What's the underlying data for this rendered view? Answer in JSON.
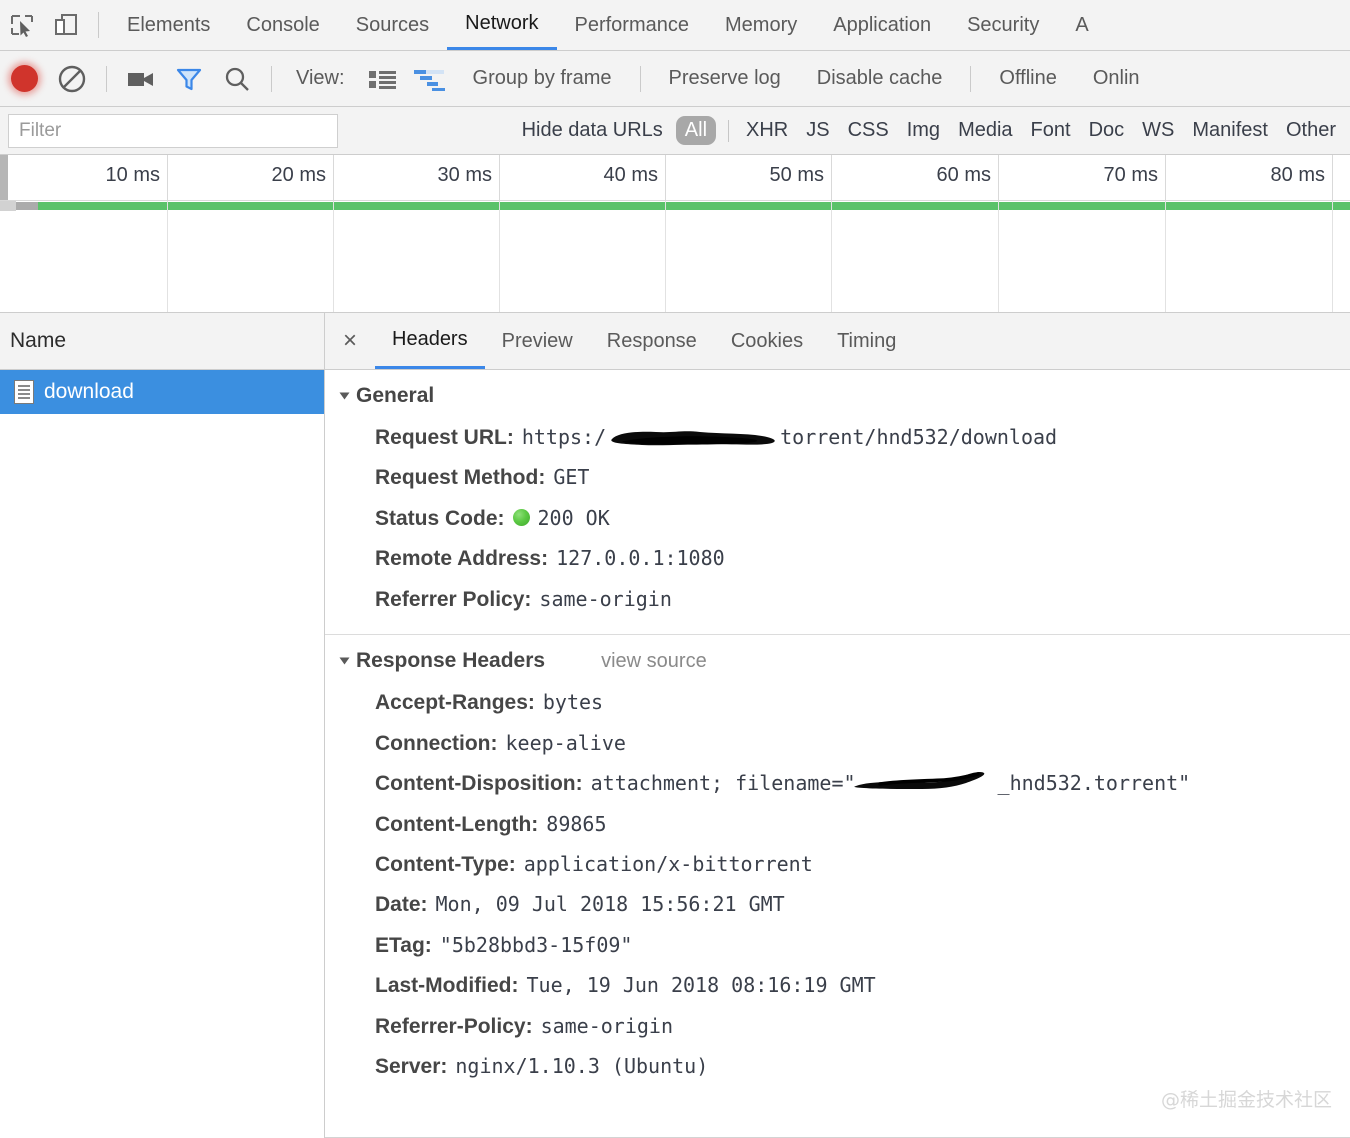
{
  "devtools": {
    "panel_tabs": [
      {
        "label": "Elements",
        "active": false
      },
      {
        "label": "Console",
        "active": false
      },
      {
        "label": "Sources",
        "active": false
      },
      {
        "label": "Network",
        "active": true
      },
      {
        "label": "Performance",
        "active": false
      },
      {
        "label": "Memory",
        "active": false
      },
      {
        "label": "Application",
        "active": false
      },
      {
        "label": "Security",
        "active": false
      },
      {
        "label": "A",
        "active": false
      }
    ],
    "left_icons": [
      {
        "name": "inspect-element-icon"
      },
      {
        "name": "device-toolbar-icon"
      }
    ]
  },
  "toolbar": {
    "record_icon": "record-icon",
    "clear_icon": "clear-icon",
    "capture_screenshots_icon": "camera-icon",
    "filter_icon": "filter-icon",
    "search_icon": "search-icon",
    "view_label": "View:",
    "view_list_icon": "list-view-icon",
    "view_waterfall_icon": "waterfall-view-icon",
    "group_by_frame": "Group by frame",
    "preserve_log": "Preserve log",
    "disable_cache": "Disable cache",
    "offline": "Offline",
    "online": "Onlin",
    "accent_blue": "#3b87e8",
    "record_red": "#d0342c"
  },
  "filter_bar": {
    "placeholder": "Filter",
    "value": "",
    "hide_data_urls": "Hide data URLs",
    "types": [
      {
        "label": "All",
        "selected": true
      },
      {
        "label": "XHR",
        "selected": false
      },
      {
        "label": "JS",
        "selected": false
      },
      {
        "label": "CSS",
        "selected": false
      },
      {
        "label": "Img",
        "selected": false
      },
      {
        "label": "Media",
        "selected": false
      },
      {
        "label": "Font",
        "selected": false
      },
      {
        "label": "Doc",
        "selected": false
      },
      {
        "label": "WS",
        "selected": false
      },
      {
        "label": "Manifest",
        "selected": false
      },
      {
        "label": "Other",
        "selected": false
      }
    ]
  },
  "overview": {
    "ticks": [
      "10 ms",
      "20 ms",
      "30 ms",
      "40 ms",
      "50 ms",
      "60 ms",
      "70 ms",
      "80 ms"
    ],
    "network_bar_color": "#5bc26a",
    "queue_bar_color": "#ababab"
  },
  "request_list": {
    "column_header": "Name",
    "rows": [
      {
        "name": "download",
        "icon": "document-icon",
        "selected": true
      }
    ],
    "selection_color": "#3b8fe0"
  },
  "details": {
    "close_label": "×",
    "tabs": [
      {
        "label": "Headers",
        "active": true
      },
      {
        "label": "Preview",
        "active": false
      },
      {
        "label": "Response",
        "active": false
      },
      {
        "label": "Cookies",
        "active": false
      },
      {
        "label": "Timing",
        "active": false
      }
    ],
    "general": {
      "title": "General",
      "request_url_label": "Request URL:",
      "request_url_prefix": "https:/",
      "request_url_suffix": "torrent/hnd532/download",
      "request_method_label": "Request Method:",
      "request_method_value": "GET",
      "status_code_label": "Status Code:",
      "status_code_value": "200 OK",
      "status_dot": "green-status-dot",
      "remote_address_label": "Remote Address:",
      "remote_address_value": "127.0.0.1:1080",
      "referrer_policy_label": "Referrer Policy:",
      "referrer_policy_value": "same-origin"
    },
    "response_headers": {
      "title": "Response Headers",
      "view_source": "view source",
      "items": [
        {
          "name": "Accept-Ranges:",
          "value": "bytes"
        },
        {
          "name": "Connection:",
          "value": "keep-alive"
        },
        {
          "name": "Content-Disposition:",
          "value_prefix": "attachment; filename=\"",
          "value_suffix": "_hnd532.torrent\"",
          "redacted": true
        },
        {
          "name": "Content-Length:",
          "value": "89865"
        },
        {
          "name": "Content-Type:",
          "value": "application/x-bittorrent"
        },
        {
          "name": "Date:",
          "value": "Mon, 09 Jul 2018 15:56:21 GMT"
        },
        {
          "name": "ETag:",
          "value": "\"5b28bbd3-15f09\""
        },
        {
          "name": "Last-Modified:",
          "value": "Tue, 19 Jun 2018 08:16:19 GMT"
        },
        {
          "name": "Referrer-Policy:",
          "value": "same-origin"
        },
        {
          "name": "Server:",
          "value": "nginx/1.10.3 (Ubuntu)"
        }
      ]
    }
  },
  "watermark": {
    "text": "@稀土掘金技术社区"
  }
}
